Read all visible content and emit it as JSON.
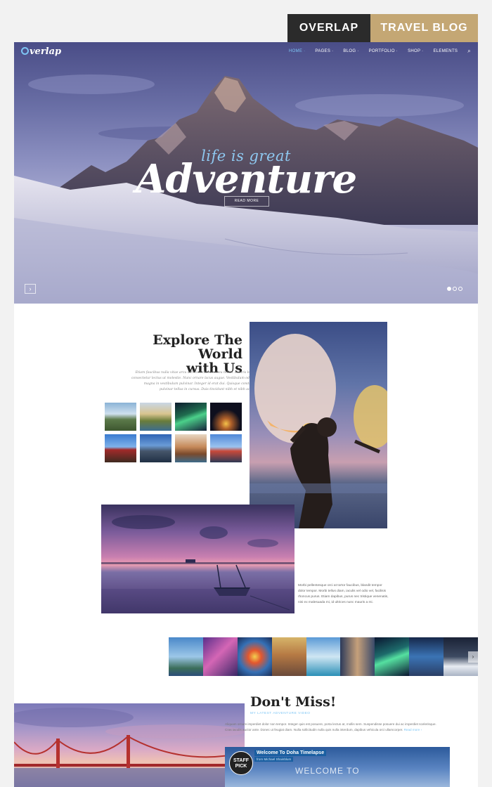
{
  "badge": {
    "left": "OVERLAP",
    "right": "TRAVEL BLOG"
  },
  "header": {
    "logo": "verlap",
    "nav": [
      {
        "label": "HOME ·"
      },
      {
        "label": "PAGES ·"
      },
      {
        "label": "BLOG ·"
      },
      {
        "label": "PORTFOLIO ·"
      },
      {
        "label": "SHOP ·"
      },
      {
        "label": "ELEMENTS"
      }
    ],
    "search_icon": "⌕"
  },
  "hero": {
    "tagline": "life is great",
    "headline": "Adventure",
    "button": "READ MORE",
    "next_arrow": "›"
  },
  "explore": {
    "title_line1": "Explore The World",
    "title_line2": "with Us",
    "text": "Etiam faucibus nulla vitae arcu ultricies cursus ac eu tellus. Mauris bibendum consectetur lectus ut molestie. Nunc ornare lacus augue. Vestibulum odio neque magna in vestibulum pulvinar. Integer id erat dui. Quisque condimentum pulvinar tellus in cursus. Duis tincidunt nibh et nibh accumsan."
  },
  "side_text": "Morbi pellentesque orci at tortor faucibus, blandit tempor dolor tempor. Morbi tellus diam, iaculis vel odio vel, facilisis rhoncus purus. Etiam dapibus, purus nec tristique venenatis, nisi ex malesuada mi, id ultrices nunc mauris a mi.",
  "dont_miss": {
    "title": "Don't Miss!",
    "subtitle": "MY LATEST ADVENTURE VIDEO",
    "text": "Aliquam ornare imperdiet dolor non tempor. Integer quis est posuere, porta lectus at, mollis sem. Suspendisse posuere dui ac imperdiet scelerisque. Cras iaculis auctor ante. Donec ut feugiat diam. Nulla sollicitudin nulla quis nulla interdum, dapibus vehicula orci ullamcorper.",
    "read_more": "Read more ›",
    "video": {
      "pick_line1": "STAFF",
      "pick_line2": "PICK",
      "title": "Welcome To Doha Timelapse",
      "byline": "from Michael Shainblum",
      "overlay": "WELCOME TO"
    }
  }
}
